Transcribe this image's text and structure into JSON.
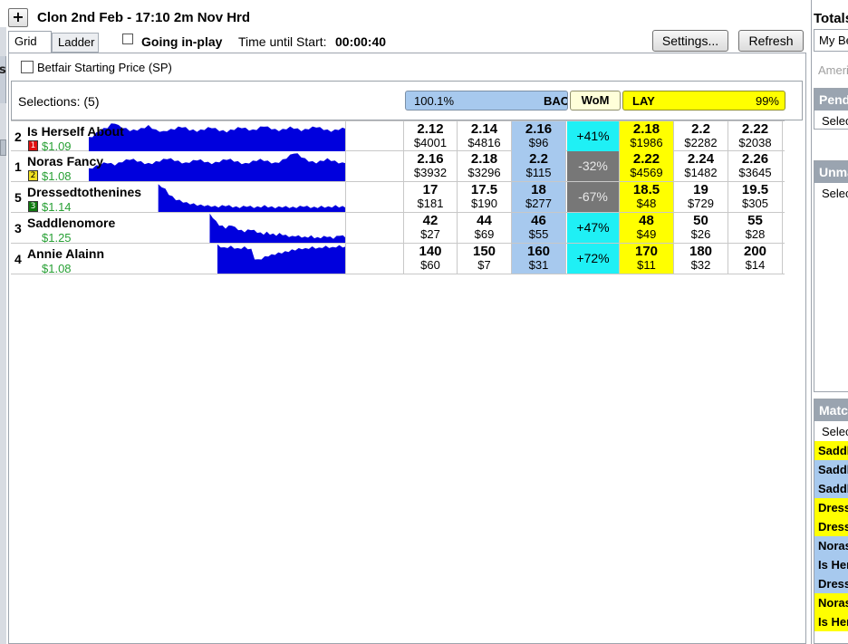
{
  "market": {
    "title": "Clon 2nd Feb - 17:10 2m Nov Hrd",
    "tabs": [
      "Grid",
      "Ladder"
    ],
    "going_inplay_label": "Going in-play",
    "countdown_label": "Time until Start:",
    "countdown_value": "00:00:40",
    "settings_label": "Settings...",
    "refresh_label": "Refresh",
    "sp_label": "Betfair Starting Price (SP)",
    "selections_label": "Selections: (5)",
    "back_book": "100.1%",
    "back_title": "BACK",
    "wom_title": "WoM",
    "lay_title": "LAY",
    "lay_book": "99%",
    "left_edge_glyph": "s"
  },
  "runners": [
    {
      "number": "2",
      "name": "Is Herself About",
      "silk_number": "1",
      "silk_color": "#e01010",
      "odds": "$1.09",
      "prices": [
        {
          "price": "2.12",
          "amount": "$4001"
        },
        {
          "price": "2.14",
          "amount": "$4816"
        },
        {
          "price": "2.16",
          "amount": "$96"
        },
        {
          "price": "2.18",
          "amount": "$1986"
        },
        {
          "price": "2.2",
          "amount": "$2282"
        },
        {
          "price": "2.22",
          "amount": "$2038"
        }
      ],
      "wom": "+41%",
      "wom_sign": "pos",
      "spark": [
        0.45,
        0.5,
        0.6,
        0.7,
        0.75,
        0.8,
        0.9,
        0.95,
        0.85,
        0.8,
        0.75,
        0.7,
        0.7,
        0.72,
        0.75,
        0.8,
        0.85,
        0.78,
        0.7,
        0.68,
        0.65,
        0.7,
        0.72,
        0.75,
        0.8,
        0.82,
        0.78,
        0.72,
        0.7,
        0.68,
        0.7,
        0.74,
        0.78,
        0.8,
        0.75,
        0.7,
        0.68,
        0.66,
        0.7,
        0.74,
        0.78,
        0.8,
        0.76,
        0.72,
        0.7,
        0.74,
        0.8,
        0.85,
        0.8,
        0.76,
        0.72,
        0.7,
        0.72,
        0.76,
        0.8,
        0.78,
        0.74,
        0.7,
        0.72,
        0.76,
        0.8,
        0.82,
        0.78,
        0.74,
        0.7,
        0.68,
        0.7,
        0.74,
        0.76,
        0.78
      ],
      "spark_start": 0.0
    },
    {
      "number": "1",
      "name": "Noras Fancy",
      "silk_number": "2",
      "silk_color": "#f0e020",
      "odds": "$1.08",
      "prices": [
        {
          "price": "2.16",
          "amount": "$3932"
        },
        {
          "price": "2.18",
          "amount": "$3296"
        },
        {
          "price": "2.2",
          "amount": "$115"
        },
        {
          "price": "2.22",
          "amount": "$4569"
        },
        {
          "price": "2.24",
          "amount": "$1482"
        },
        {
          "price": "2.26",
          "amount": "$3645"
        }
      ],
      "wom": "-32%",
      "wom_sign": "neg",
      "spark": [
        0.4,
        0.45,
        0.5,
        0.55,
        0.6,
        0.62,
        0.58,
        0.55,
        0.6,
        0.66,
        0.7,
        0.74,
        0.72,
        0.68,
        0.64,
        0.6,
        0.58,
        0.6,
        0.64,
        0.68,
        0.72,
        0.76,
        0.74,
        0.7,
        0.66,
        0.62,
        0.6,
        0.64,
        0.68,
        0.72,
        0.7,
        0.66,
        0.62,
        0.6,
        0.62,
        0.66,
        0.7,
        0.74,
        0.72,
        0.68,
        0.64,
        0.6,
        0.58,
        0.62,
        0.66,
        0.7,
        0.72,
        0.7,
        0.66,
        0.62,
        0.6,
        0.64,
        0.7,
        0.78,
        0.86,
        0.95,
        0.9,
        0.82,
        0.74,
        0.68,
        0.64,
        0.62,
        0.66,
        0.7,
        0.74,
        0.7,
        0.66,
        0.62,
        0.6,
        0.62
      ],
      "spark_start": 0.0
    },
    {
      "number": "5",
      "name": "Dressedtothenines",
      "silk_number": "3",
      "silk_color": "#107a10",
      "odds": "$1.14",
      "prices": [
        {
          "price": "17",
          "amount": "$181"
        },
        {
          "price": "17.5",
          "amount": "$190"
        },
        {
          "price": "18",
          "amount": "$277"
        },
        {
          "price": "18.5",
          "amount": "$48"
        },
        {
          "price": "19",
          "amount": "$729"
        },
        {
          "price": "19.5",
          "amount": "$305"
        }
      ],
      "wom": "-67%",
      "wom_sign": "neg",
      "spark": [
        0.9,
        0.85,
        0.75,
        0.6,
        0.5,
        0.42,
        0.38,
        0.34,
        0.3,
        0.28,
        0.26,
        0.24,
        0.22,
        0.22,
        0.2,
        0.2,
        0.18,
        0.18,
        0.2,
        0.22,
        0.2,
        0.18,
        0.16,
        0.16,
        0.18,
        0.2,
        0.18,
        0.16,
        0.16,
        0.18,
        0.2,
        0.18,
        0.16,
        0.15,
        0.16,
        0.18,
        0.17,
        0.16,
        0.15,
        0.16,
        0.18,
        0.2,
        0.18,
        0.16,
        0.15,
        0.16,
        0.18,
        0.17,
        0.16,
        0.18,
        0.2,
        0.18,
        0.17,
        0.16
      ],
      "spark_start": 0.27
    },
    {
      "number": "3",
      "name": "Saddlenomore",
      "silk_number": "",
      "silk_color": "",
      "odds": "$1.25",
      "prices": [
        {
          "price": "42",
          "amount": "$27"
        },
        {
          "price": "44",
          "amount": "$69"
        },
        {
          "price": "46",
          "amount": "$55"
        },
        {
          "price": "48",
          "amount": "$49"
        },
        {
          "price": "50",
          "amount": "$26"
        },
        {
          "price": "55",
          "amount": "$28"
        }
      ],
      "wom": "+47%",
      "wom_sign": "pos",
      "spark": [
        0.95,
        0.85,
        0.7,
        0.6,
        0.55,
        0.5,
        0.55,
        0.6,
        0.5,
        0.45,
        0.4,
        0.38,
        0.42,
        0.45,
        0.4,
        0.36,
        0.32,
        0.3,
        0.34,
        0.3,
        0.28,
        0.26,
        0.3,
        0.28,
        0.24,
        0.22,
        0.2,
        0.24,
        0.22,
        0.2,
        0.18,
        0.2,
        0.22,
        0.18,
        0.16,
        0.18,
        0.2,
        0.22,
        0.18,
        0.16,
        0.2,
        0.26,
        0.22,
        0.18
      ],
      "spark_start": 0.47
    },
    {
      "number": "4",
      "name": "Annie Alainn",
      "silk_number": "",
      "silk_color": "",
      "odds": "$1.08",
      "prices": [
        {
          "price": "140",
          "amount": "$60"
        },
        {
          "price": "150",
          "amount": "$7"
        },
        {
          "price": "160",
          "amount": "$31"
        },
        {
          "price": "170",
          "amount": "$11"
        },
        {
          "price": "180",
          "amount": "$32"
        },
        {
          "price": "200",
          "amount": "$14"
        }
      ],
      "wom": "+72%",
      "wom_sign": "pos",
      "spark": [
        0.95,
        0.9,
        0.85,
        0.88,
        0.9,
        0.86,
        0.82,
        0.85,
        0.88,
        0.84,
        0.8,
        0.5,
        0.45,
        0.5,
        0.55,
        0.6,
        0.62,
        0.65,
        0.68,
        0.7,
        0.72,
        0.75,
        0.78,
        0.8,
        0.82,
        0.84,
        0.82,
        0.85,
        0.88,
        0.86,
        0.84,
        0.88,
        0.9,
        0.88,
        0.86,
        0.9,
        0.92,
        0.9,
        0.88
      ],
      "spark_start": 0.5
    }
  ],
  "sidebar": {
    "title": "Totals",
    "tab_label": "My Bets",
    "hint": "American",
    "pending_title": "Pending",
    "pending_select": "Select",
    "unmatched_title": "Unmatched",
    "unmatched_select": "Select",
    "matched_title": "Matched",
    "matched_select": "Select",
    "matched_items": [
      {
        "label": "Saddlenomore",
        "side": "lay"
      },
      {
        "label": "Saddlenomore",
        "side": "back"
      },
      {
        "label": "Saddlenomore",
        "side": "back"
      },
      {
        "label": "Dressedtothenines",
        "side": "lay"
      },
      {
        "label": "Dressedtothenines",
        "side": "lay"
      },
      {
        "label": "Noras Fancy",
        "side": "back"
      },
      {
        "label": "Is Herself About",
        "side": "back"
      },
      {
        "label": "Dressedtothenines",
        "side": "back"
      },
      {
        "label": "Noras Fancy",
        "side": "lay"
      },
      {
        "label": "Is Herself About",
        "side": "lay"
      }
    ]
  },
  "colors": {
    "back": "#a7c9ee",
    "lay": "#ffff00",
    "wom_positive": "#1ff0f5",
    "wom_negative": "#777777",
    "odds_green": "#27a034",
    "spark_fill": "#0000dd",
    "sidebar_header": "#9aa4b0"
  }
}
